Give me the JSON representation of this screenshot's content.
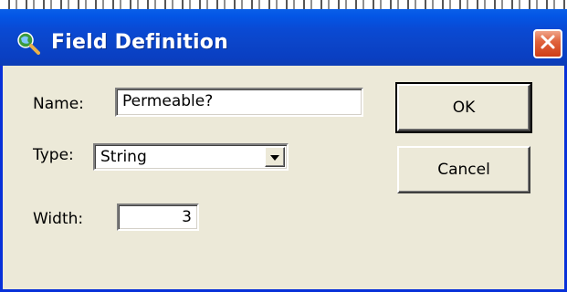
{
  "window": {
    "title": "Field Definition",
    "title_icon": "magnifier-globe-icon",
    "close_icon": "close-x-icon"
  },
  "form": {
    "name_label": "Name:",
    "name_value": "Permeable?",
    "type_label": "Type:",
    "type_value": "String",
    "width_label": "Width:",
    "width_value": "3"
  },
  "buttons": {
    "ok_label": "OK",
    "cancel_label": "Cancel"
  },
  "colors": {
    "titlebar": "#0a4ad4",
    "dialog_bg": "#ece9d8",
    "close_button": "#e0643e"
  }
}
